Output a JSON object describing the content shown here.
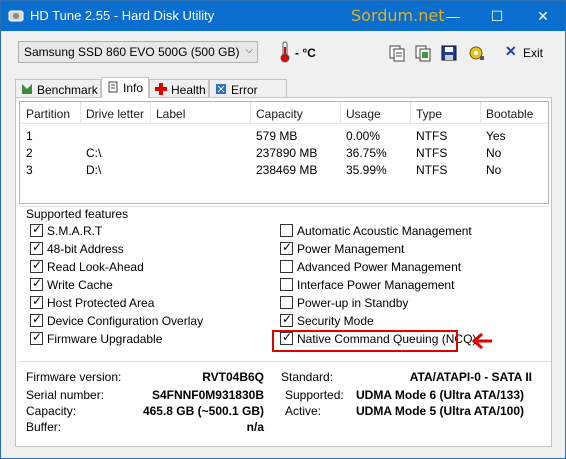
{
  "window": {
    "title": "HD Tune 2.55 - Hard Disk Utility",
    "watermark": "Sordum.net",
    "minimize_glyph": "—",
    "maximize_glyph": "☐",
    "close_glyph": "✕"
  },
  "toolbar": {
    "drive": "Samsung SSD 860 EVO 500G (500 GB)",
    "temperature": "- °C",
    "icons": [
      "copy-info-icon",
      "copy-screenshot-icon",
      "save-icon",
      "options-icon"
    ],
    "exit_label": "Exit"
  },
  "tabs": [
    {
      "label": "Benchmark",
      "icon": "benchmark-icon"
    },
    {
      "label": "Info",
      "icon": "info-icon",
      "active": true
    },
    {
      "label": "Health",
      "icon": "health-icon"
    },
    {
      "label": "Error Scan",
      "icon": "error-scan-icon"
    }
  ],
  "partitions": {
    "columns": [
      "Partition",
      "Drive letter",
      "Label",
      "Capacity",
      "Usage",
      "Type",
      "Bootable"
    ],
    "rows": [
      [
        "1",
        "",
        "",
        "579 MB",
        "0.00%",
        "NTFS",
        "Yes"
      ],
      [
        "2",
        "C:\\",
        "",
        "237890 MB",
        "36.75%",
        "NTFS",
        "No"
      ],
      [
        "3",
        "D:\\",
        "",
        "238469 MB",
        "35.99%",
        "NTFS",
        "No"
      ]
    ]
  },
  "features": {
    "title": "Supported features",
    "left": [
      {
        "label": "S.M.A.R.T",
        "checked": true
      },
      {
        "label": "48-bit Address",
        "checked": true
      },
      {
        "label": "Read Look-Ahead",
        "checked": true
      },
      {
        "label": "Write Cache",
        "checked": true
      },
      {
        "label": "Host Protected Area",
        "checked": true
      },
      {
        "label": "Device Configuration Overlay",
        "checked": true
      },
      {
        "label": "Firmware Upgradable",
        "checked": true
      }
    ],
    "right": [
      {
        "label": "Automatic Acoustic Management",
        "checked": false
      },
      {
        "label": "Power Management",
        "checked": true
      },
      {
        "label": "Advanced Power Management",
        "checked": false
      },
      {
        "label": "Interface Power Management",
        "checked": false
      },
      {
        "label": "Power-up in Standby",
        "checked": false
      },
      {
        "label": "Security Mode",
        "checked": true
      },
      {
        "label": "Native Command Queuing (NCQ)",
        "checked": true
      }
    ],
    "highlight_color": "#e00000"
  },
  "info": {
    "firmware_label": "Firmware version:",
    "firmware": "RVT04B6Q",
    "serial_label": "Serial number:",
    "serial": "S4FNNF0M931830B",
    "capacity_label": "Capacity:",
    "capacity": "465.8 GB (~500.1 GB)",
    "buffer_label": "Buffer:",
    "buffer": "n/a",
    "standard_label": "Standard:",
    "standard": "ATA/ATAPI-0 - SATA II",
    "supported_label": "Supported:",
    "supported": "UDMA Mode 6 (Ultra ATA/133)",
    "active_label": "Active:",
    "active": "UDMA Mode 5 (Ultra ATA/100)"
  },
  "colors": {
    "titlebar": "#0a6ece",
    "accent_red": "#e00000"
  }
}
